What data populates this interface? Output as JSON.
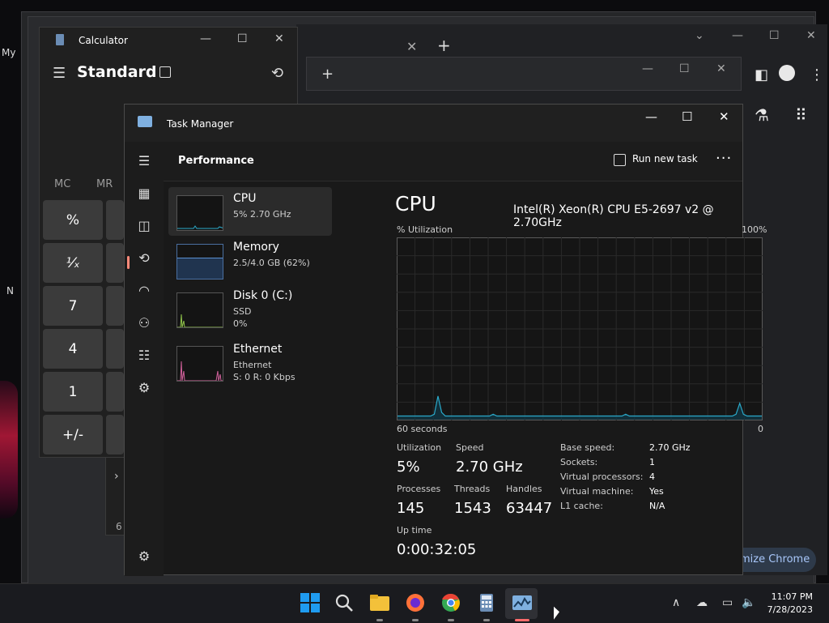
{
  "desktop": {
    "label_my": "My",
    "label_n": "N"
  },
  "chrome": {
    "new_tab": "+",
    "close_tab": "✕",
    "customize": "mize Chrome"
  },
  "calculator": {
    "title": "Calculator",
    "mode": "Standard",
    "memory": [
      "MC",
      "MR"
    ],
    "keys": [
      "%",
      "¹⁄ₓ",
      "7",
      "4",
      "1",
      "+/-"
    ],
    "lower_digit": "6"
  },
  "task_manager": {
    "title": "Task Manager",
    "page": "Performance",
    "run_new_task": "Run new task",
    "more": "···",
    "resources": [
      {
        "name": "CPU",
        "lines": [
          "5% 2.70 GHz"
        ]
      },
      {
        "name": "Memory",
        "lines": [
          "2.5/4.0 GB (62%)"
        ]
      },
      {
        "name": "Disk 0 (C:)",
        "lines": [
          "SSD",
          "0%"
        ]
      },
      {
        "name": "Ethernet",
        "lines": [
          "Ethernet",
          "S: 0 R: 0 Kbps"
        ]
      }
    ],
    "cpu": {
      "heading": "CPU",
      "model": "Intel(R) Xeon(R) CPU E5-2697 v2 @ 2.70GHz",
      "util_label": "% Utilization",
      "max_label": "100%",
      "time_label": "60 seconds",
      "min_label": "0",
      "utilization_series": [
        2,
        2,
        2,
        2,
        2,
        2,
        2,
        2,
        2,
        2,
        3,
        13,
        4,
        2,
        2,
        2,
        2,
        2,
        2,
        2,
        2,
        2,
        2,
        2,
        2,
        2,
        3,
        2,
        2,
        2,
        2,
        2,
        2,
        2,
        2,
        2,
        2,
        2,
        2,
        2,
        2,
        2,
        2,
        2,
        2,
        2,
        2,
        2,
        2,
        2,
        2,
        2,
        2,
        2,
        2,
        2,
        2,
        2,
        2,
        2,
        2,
        2,
        3,
        2,
        2,
        2,
        2,
        2,
        2,
        2,
        2,
        2,
        2,
        2,
        2,
        2,
        2,
        2,
        2,
        2,
        2,
        2,
        2,
        2,
        2,
        2,
        2,
        2,
        2,
        2,
        2,
        2,
        3,
        9,
        3,
        2,
        2,
        2,
        2,
        2
      ]
    },
    "stats": {
      "utilization_label": "Utilization",
      "utilization": "5%",
      "speed_label": "Speed",
      "speed": "2.70 GHz",
      "processes_label": "Processes",
      "processes": "145",
      "threads_label": "Threads",
      "threads": "1543",
      "handles_label": "Handles",
      "handles": "63447",
      "uptime_label": "Up time",
      "uptime": "0:00:32:05"
    },
    "details": [
      {
        "k": "Base speed:",
        "v": "2.70 GHz"
      },
      {
        "k": "Sockets:",
        "v": "1"
      },
      {
        "k": "Virtual processors:",
        "v": "4"
      },
      {
        "k": "Virtual machine:",
        "v": "Yes"
      },
      {
        "k": "L1 cache:",
        "v": "N/A"
      }
    ]
  },
  "taskbar": {
    "time": "11:07 PM",
    "date": "7/28/2023",
    "colors": {
      "windows": "#1f9bf0",
      "explorer": "#f3c13a",
      "firefox": "#ff7139",
      "chrome": "#34a853",
      "calculator": "#6b8db5",
      "taskmanager": "#7fb0e0",
      "indicator": "#ff6b6b"
    }
  }
}
